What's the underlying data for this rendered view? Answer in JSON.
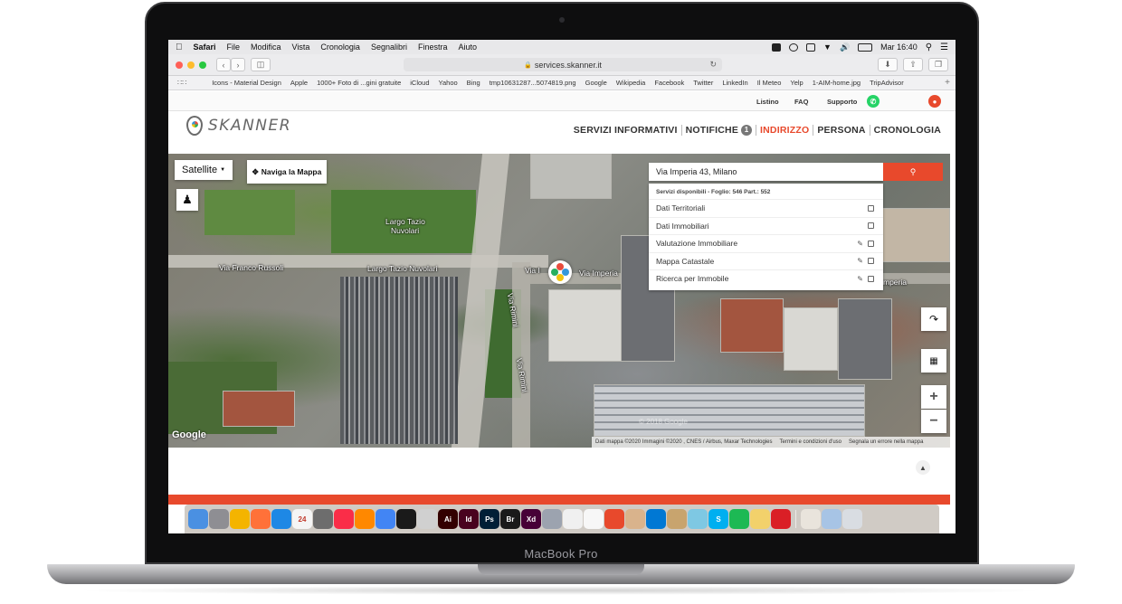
{
  "device": {
    "label": "MacBook Pro"
  },
  "menubar": {
    "app": "Safari",
    "items": [
      "File",
      "Modifica",
      "Vista",
      "Cronologia",
      "Segnalibri",
      "Finestra",
      "Aiuto"
    ],
    "clock": "Mar 16:40"
  },
  "browser": {
    "url": "services.skanner.it",
    "bookmarks": [
      "Icons - Material Design",
      "Apple",
      "1000+ Foto di ...gini gratuite",
      "iCloud",
      "Yahoo",
      "Bing",
      "tmp10631287...5074819.png",
      "Google",
      "Wikipedia",
      "Facebook",
      "Twitter",
      "LinkedIn",
      "Il Meteo",
      "Yelp",
      "1-AIM-home.jpg",
      "TripAdvisor"
    ]
  },
  "topbar": {
    "listino": "Listino",
    "faq": "FAQ",
    "supporto": "Supporto"
  },
  "header": {
    "logo": "SKANNER",
    "nav": {
      "servizi": "SERVIZI INFORMATIVI",
      "notifiche": "NOTIFICHE",
      "notifiche_count": "1",
      "indirizzo": "INDIRIZZO",
      "persona": "PERSONA",
      "cronologia": "CRONOLOGIA"
    }
  },
  "map": {
    "type_select": "Satellite",
    "navigate_button": "Naviga la Mappa",
    "search_value": "Via Imperia 43, Milano",
    "services_header": "Servizi disponibili - Foglio: 546 Part.: 552",
    "services": [
      {
        "label": "Dati Territoriali",
        "editable": false
      },
      {
        "label": "Dati Immobiliari",
        "editable": false
      },
      {
        "label": "Valutazione Immobiliare",
        "editable": true
      },
      {
        "label": "Mappa Catastale",
        "editable": true
      },
      {
        "label": "Ricerca per Immobile",
        "editable": true
      }
    ],
    "labels": {
      "largo_tazio_1": "Largo Tazio",
      "largo_tazio_2": "Nuvolari",
      "via_franco_russoli": "Via Franco Russoli",
      "largo_tazio_nuvolari": "Largo Tazio Nuvolari",
      "via_i": "Via I",
      "via_imperia": "Via Imperia",
      "via_rimini_1": "Via Rimini",
      "via_rimini_2": "Via Rimini",
      "imperia_right": "mperia"
    },
    "google_logo": "Google",
    "watermark": "© 2018 Google",
    "footer": {
      "attribution": "Dati mappa ©2020 Immagini ©2020 , CNES / Airbus, Maxar Technologies",
      "terms": "Termini e condizioni d'uso",
      "report": "Segnala un errore nella mappa"
    }
  },
  "dock_apps": [
    {
      "name": "finder",
      "color": "#4a90e2"
    },
    {
      "name": "system-preferences",
      "color": "#8e8e93"
    },
    {
      "name": "chrome",
      "color": "#f4b400"
    },
    {
      "name": "firefox",
      "color": "#ff7139"
    },
    {
      "name": "safari",
      "color": "#1e88e5"
    },
    {
      "name": "calendar",
      "color": "#f5f5f5",
      "text": "24"
    },
    {
      "name": "preview",
      "color": "#6d6d6d"
    },
    {
      "name": "music",
      "color": "#fa2d48"
    },
    {
      "name": "vlc",
      "color": "#ff8800"
    },
    {
      "name": "google-lens",
      "color": "#4285f4"
    },
    {
      "name": "acrobat",
      "color": "#1a1a1a"
    },
    {
      "name": "acrobat-reader",
      "color": "#d0d0d0"
    },
    {
      "name": "illustrator",
      "color": "#330000",
      "text": "Ai"
    },
    {
      "name": "indesign",
      "color": "#49021f",
      "text": "Id"
    },
    {
      "name": "photoshop",
      "color": "#001e36",
      "text": "Ps"
    },
    {
      "name": "bridge",
      "color": "#1a1a1a",
      "text": "Br"
    },
    {
      "name": "xd",
      "color": "#470137",
      "text": "Xd"
    },
    {
      "name": "image-capture",
      "color": "#9ca3af"
    },
    {
      "name": "textedit",
      "color": "#f0f0f0"
    },
    {
      "name": "pages",
      "color": "#f7f7f7"
    },
    {
      "name": "xmind",
      "color": "#e8492c"
    },
    {
      "name": "notes",
      "color": "#d9b38c"
    },
    {
      "name": "vscode",
      "color": "#0078d4"
    },
    {
      "name": "sketch-notebook",
      "color": "#c8a46e"
    },
    {
      "name": "photos",
      "color": "#7ec8e3"
    },
    {
      "name": "skype",
      "color": "#00aff0",
      "text": "S"
    },
    {
      "name": "spotify",
      "color": "#1db954"
    },
    {
      "name": "script-editor",
      "color": "#f2d16b"
    },
    {
      "name": "creative-cloud",
      "color": "#da1f26"
    },
    {
      "name": "downloads-stack",
      "color": "#e9e4dc"
    },
    {
      "name": "documents-stack",
      "color": "#a7c4e5"
    },
    {
      "name": "trash",
      "color": "#d9dde2"
    }
  ]
}
